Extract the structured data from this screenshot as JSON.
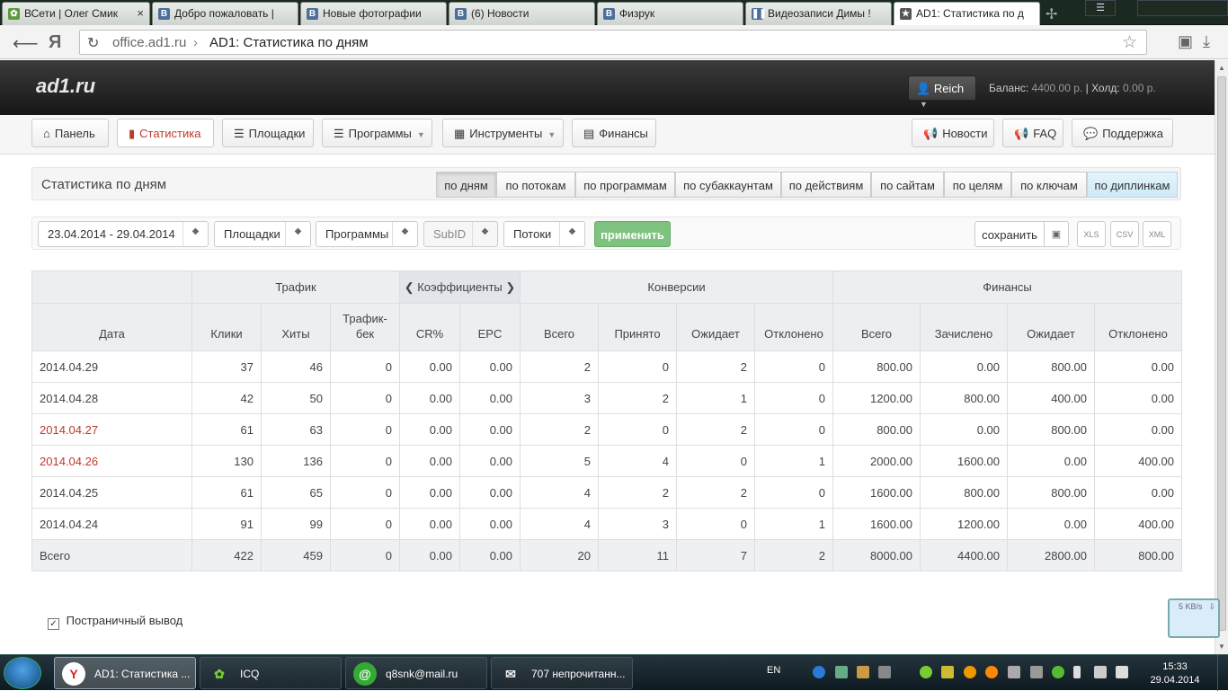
{
  "browser": {
    "tabs": [
      {
        "label": "ВСети | Олег Смик",
        "icon": "vseti-icon",
        "active": false
      },
      {
        "label": "Добро пожаловать |",
        "icon": "vk-icon",
        "active": false
      },
      {
        "label": "Новые фотографии",
        "icon": "vk-icon",
        "active": false
      },
      {
        "label": "(6) Новости",
        "icon": "vk-icon",
        "active": false
      },
      {
        "label": "Физрук",
        "icon": "vk-icon",
        "active": false
      },
      {
        "label": "Видеозаписи Димы !",
        "icon": "pause-icon",
        "active": false
      },
      {
        "label": "AD1: Статистика по д",
        "icon": "star-icon",
        "active": true
      }
    ],
    "address": {
      "host": "office.ad1.ru",
      "separator": "›",
      "page_title": "AD1: Статистика по дням"
    }
  },
  "header": {
    "logo": "ad1.ru",
    "user": "Reich",
    "balance_label": "Баланс:",
    "balance_value": "4400.00 р.",
    "divider": "|",
    "hold_label": "Холд:",
    "hold_value": "0.00 р."
  },
  "nav": {
    "panel": "Панель",
    "stats": "Статистика",
    "platforms": "Площадки",
    "programs": "Программы",
    "tools": "Инструменты",
    "finance": "Финансы",
    "news": "Новости",
    "faq": "FAQ",
    "support": "Поддержка"
  },
  "filterbar": {
    "title": "Статистика по дням",
    "segments": [
      "по дням",
      "по потокам",
      "по программам",
      "по субаккаунтам",
      "по действиям",
      "по сайтам",
      "по целям",
      "по ключам",
      "по диплинкам"
    ],
    "active_segment": "по дням"
  },
  "controls": {
    "date_range": "23.04.2014 - 29.04.2014",
    "platforms": "Площадки",
    "programs": "Программы",
    "subid": "SubID",
    "streams": "Потоки",
    "apply": "применить",
    "save": "сохранить",
    "exports": [
      "XLS",
      "CSV",
      "XML"
    ]
  },
  "table": {
    "groups": {
      "traffic": "Трафик",
      "coef": "Коэффициенты",
      "conversions": "Конверсии",
      "finance": "Финансы"
    },
    "columns": [
      "Дата",
      "Клики",
      "Хиты",
      "Трафик-бек",
      "CR%",
      "EPC",
      "Всего",
      "Принято",
      "Ожидает",
      "Отклонено",
      "Всего",
      "Зачислено",
      "Ожидает",
      "Отклонено"
    ],
    "rows": [
      {
        "date": "2014.04.29",
        "weekend": false,
        "cells": [
          "37",
          "46",
          "0",
          "0.00",
          "0.00",
          "2",
          "0",
          "2",
          "0",
          "800.00",
          "0.00",
          "800.00",
          "0.00"
        ]
      },
      {
        "date": "2014.04.28",
        "weekend": false,
        "cells": [
          "42",
          "50",
          "0",
          "0.00",
          "0.00",
          "3",
          "2",
          "1",
          "0",
          "1200.00",
          "800.00",
          "400.00",
          "0.00"
        ]
      },
      {
        "date": "2014.04.27",
        "weekend": true,
        "cells": [
          "61",
          "63",
          "0",
          "0.00",
          "0.00",
          "2",
          "0",
          "2",
          "0",
          "800.00",
          "0.00",
          "800.00",
          "0.00"
        ]
      },
      {
        "date": "2014.04.26",
        "weekend": true,
        "cells": [
          "130",
          "136",
          "0",
          "0.00",
          "0.00",
          "5",
          "4",
          "0",
          "1",
          "2000.00",
          "1600.00",
          "0.00",
          "400.00"
        ]
      },
      {
        "date": "2014.04.25",
        "weekend": false,
        "cells": [
          "61",
          "65",
          "0",
          "0.00",
          "0.00",
          "4",
          "2",
          "2",
          "0",
          "1600.00",
          "800.00",
          "800.00",
          "0.00"
        ]
      },
      {
        "date": "2014.04.24",
        "weekend": false,
        "cells": [
          "91",
          "99",
          "0",
          "0.00",
          "0.00",
          "4",
          "3",
          "0",
          "1",
          "1600.00",
          "1200.00",
          "0.00",
          "400.00"
        ]
      }
    ],
    "total": {
      "label": "Всего",
      "cells": [
        "422",
        "459",
        "0",
        "0.00",
        "0.00",
        "20",
        "11",
        "7",
        "2",
        "8000.00",
        "4400.00",
        "2800.00",
        "800.00"
      ]
    }
  },
  "pagination_checkbox": {
    "label": "Постраничный вывод",
    "checked": true
  },
  "speed_widget": "5 KB/s",
  "taskbar": {
    "items": [
      {
        "label": "AD1: Статистика ...",
        "icon": "yandex-browser-icon",
        "active": true
      },
      {
        "label": "ICQ",
        "icon": "icq-icon",
        "active": false
      },
      {
        "label": "q8snk@mail.ru",
        "icon": "mail-agent-icon",
        "active": false
      },
      {
        "label": "707 непрочитанн...",
        "icon": "envelope-icon",
        "active": false
      }
    ],
    "lang": "EN",
    "time": "15:33",
    "date": "29.04.2014"
  }
}
